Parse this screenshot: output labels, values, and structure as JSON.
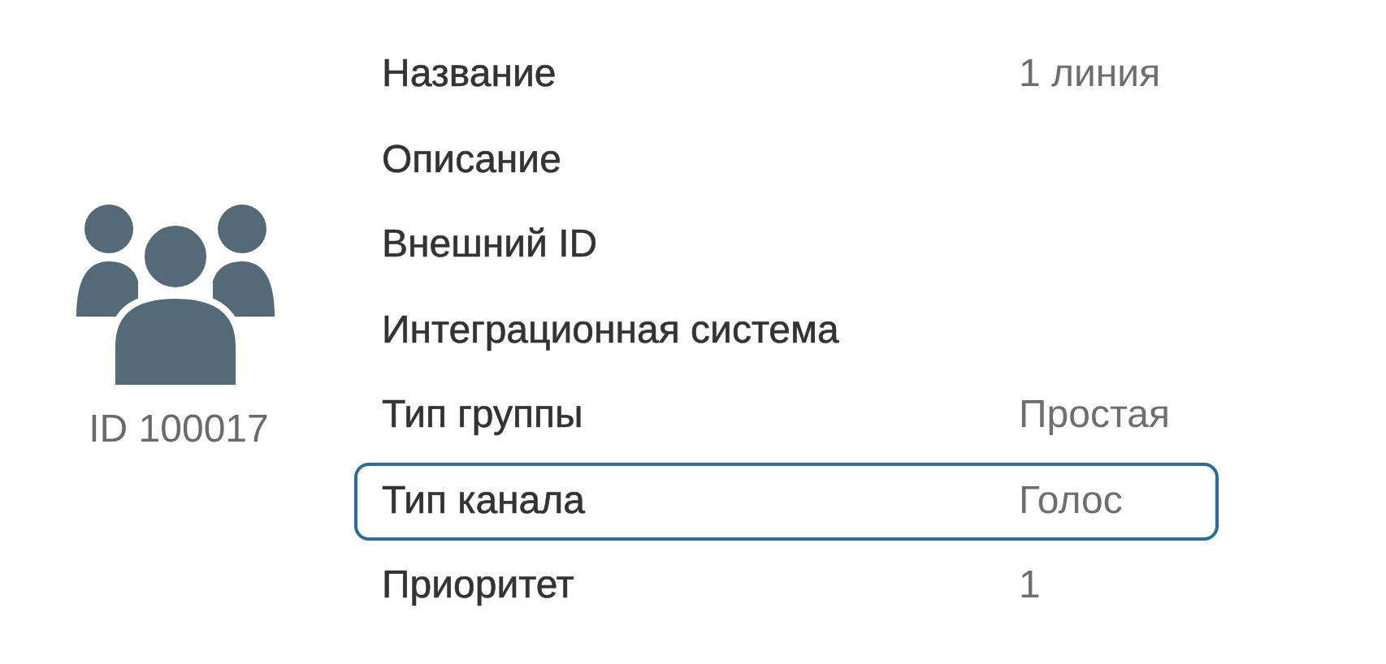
{
  "profile": {
    "id_label": "ID 100017"
  },
  "fields": [
    {
      "label": "Название",
      "value": "1 линия",
      "highlighted": false
    },
    {
      "label": "Описание",
      "highlighted": false
    },
    {
      "label": "Внешний ID",
      "highlighted": false
    },
    {
      "label": "Интеграционная система",
      "highlighted": false
    },
    {
      "label": "Тип группы",
      "value": "Простая",
      "highlighted": false
    },
    {
      "label": "Тип канала",
      "value": "Голос",
      "highlighted": true
    },
    {
      "label": "Приоритет",
      "value": "1",
      "highlighted": false
    }
  ]
}
